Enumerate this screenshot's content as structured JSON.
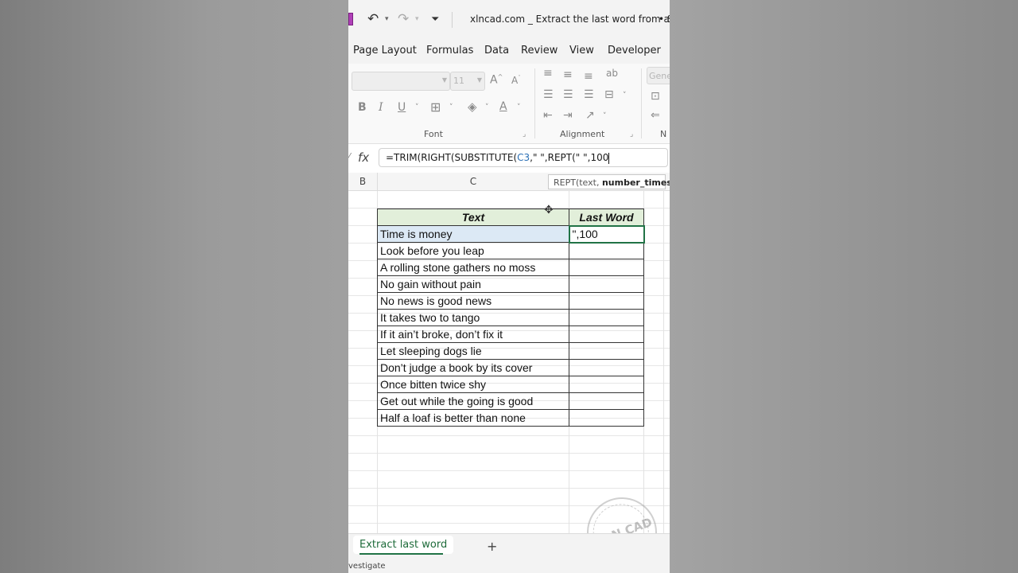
{
  "title_bar": {
    "document_title": "xlncad.com _ Extract the last word from a...",
    "save_status": "• S"
  },
  "ribbon_tabs": [
    "Page Layout",
    "Formulas",
    "Data",
    "Review",
    "View",
    "Developer"
  ],
  "ribbon": {
    "font_size": "11",
    "font_group_label": "Font",
    "alignment_group_label": "Alignment",
    "number_format": "Gene",
    "number_group_label_partial": "N",
    "bold_label": "B",
    "italic_label": "I",
    "underline_label": "U"
  },
  "formula_bar": {
    "fx_label": "fx",
    "formula_prefix": "=TRIM(RIGHT(SUBSTITUTE(",
    "formula_ref": "C3",
    "formula_mid": ",\" \",REPT(\" \",100",
    "tooltip_fn": "REPT(text, ",
    "tooltip_arg": "number_times",
    "tooltip_close": ")"
  },
  "columns": {
    "b": "B",
    "c": "C"
  },
  "table": {
    "header_text": "Text",
    "header_last_word": "Last Word",
    "editing_value": "\",100",
    "rows": [
      "Time is money",
      "Look before you leap",
      "A rolling stone gathers no moss",
      "No gain without pain",
      "No news is good news",
      "It takes two to tango",
      "If it ain’t broke, don’t fix it",
      "Let sleeping dogs lie",
      "Don’t judge a book by its cover",
      "Once bitten twice shy",
      "Get out while the going is good",
      "Half a loaf is better than none"
    ]
  },
  "sheet_tabs": {
    "active": "Extract last word",
    "add": "+"
  },
  "status_bar": {
    "text": "vestigate"
  },
  "watermark": {
    "text": "XL N CAD"
  },
  "colors": {
    "excel_green": "#217346",
    "header_fill": "#e2efda",
    "selected_cell_fill": "#dce9f5"
  }
}
